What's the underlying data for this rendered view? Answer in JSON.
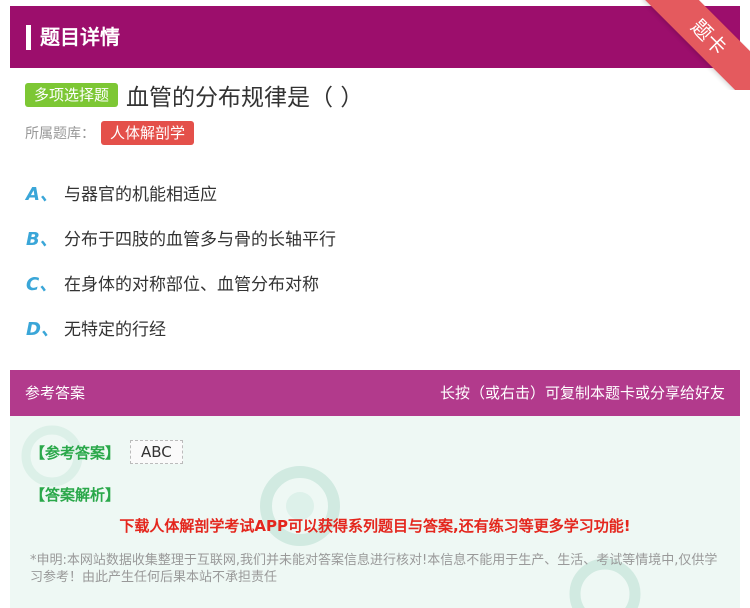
{
  "header": {
    "title": "题目详情",
    "ribbon": "题卡"
  },
  "question": {
    "type": "多项选择题",
    "text": "血管的分布规律是（  ）",
    "library_label": "所属题库：",
    "library": "人体解剖学"
  },
  "options": [
    {
      "letter": "A、",
      "text": "与器官的机能相适应"
    },
    {
      "letter": "B、",
      "text": "分布于四肢的血管多与骨的长轴平行"
    },
    {
      "letter": "C、",
      "text": "在身体的对称部位、血管分布对称"
    },
    {
      "letter": "D、",
      "text": "无特定的行经"
    }
  ],
  "answer_bar": {
    "left": "参考答案",
    "right": "长按（或右击）可复制本题卡或分享给好友"
  },
  "answer": {
    "label": "【参考答案】",
    "value": "ABC",
    "analysis_label": "【答案解析】",
    "promo": "下载人体解剖学考试APP可以获得系列题目与答案,还有练习等更多学习功能!",
    "disclaimer": "*申明:本网站数据收集整理于互联网,我们并未能对答案信息进行核对!本信息不能用于生产、生活、考试等情境中,仅供学习参考！由此产生任何后果本站不承担责任"
  },
  "colors": {
    "header": "#9c0e6c",
    "ribbon": "#e45a5e",
    "type_badge": "#7dc734",
    "library_badge": "#e4504a",
    "option_letter": "#3aa6d8",
    "answer_bar": "#b23a8c",
    "answer_bg": "#eef8f4",
    "answer_label": "#2aa84a",
    "promo": "#e4261d"
  }
}
